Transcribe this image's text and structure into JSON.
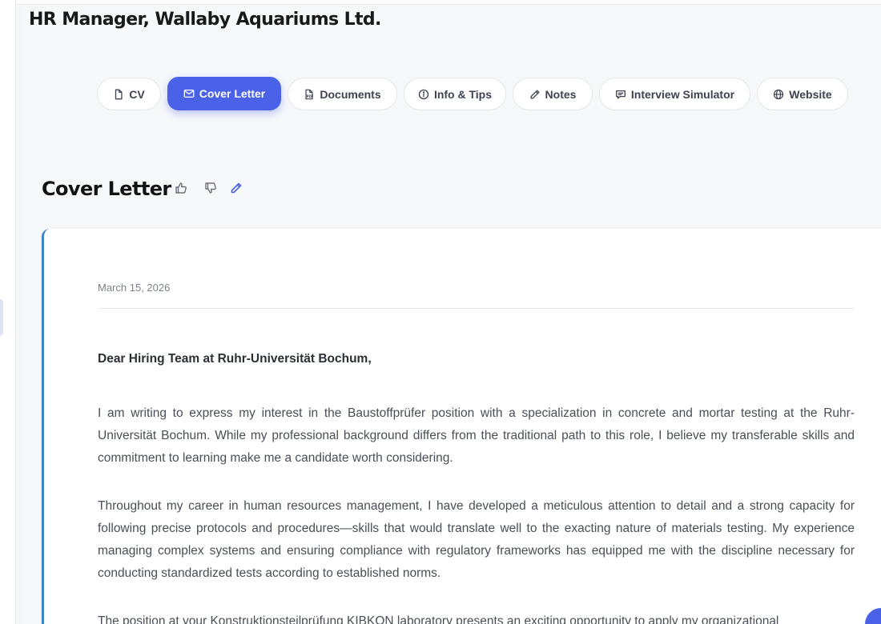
{
  "header": {
    "company_title": "HR Manager, Wallaby Aquariums Ltd."
  },
  "tabs": [
    {
      "label": "CV",
      "icon": "file-icon",
      "active": false
    },
    {
      "label": "Cover Letter",
      "icon": "mail-icon",
      "active": true
    },
    {
      "label": "Documents",
      "icon": "pdf-file-icon",
      "active": false
    },
    {
      "label": "Info & Tips",
      "icon": "info-icon",
      "active": false
    },
    {
      "label": "Notes",
      "icon": "pencil-icon",
      "active": false
    },
    {
      "label": "Interview Simulator",
      "icon": "chat-icon",
      "active": false
    },
    {
      "label": "Website",
      "icon": "globe-icon",
      "active": false
    }
  ],
  "section": {
    "title": "Cover Letter",
    "actions": [
      "thumbs-up-icon",
      "thumbs-down-icon",
      "edit-icon"
    ]
  },
  "letter": {
    "date": "March 15, 2026",
    "greeting": "Dear Hiring Team at Ruhr-Universität Bochum,",
    "paragraphs": [
      "I am writing to express my interest in the Baustoffprüfer position with a specialization in concrete and mortar testing at the Ruhr-Universität Bochum. While my professional background differs from the traditional path to this role, I believe my transferable skills and commitment to learning make me a candidate worth considering.",
      "Throughout my career in human resources management, I have developed a meticulous attention to detail and a strong capacity for following precise protocols and procedures—skills that would translate well to the exacting nature of materials testing. My experience managing complex systems and ensuring compliance with regulatory frameworks has equipped me with the discipline necessary for conducting standardized tests according to established norms.",
      "The position at your Konstruktionsteilprüfung KIBKON laboratory presents an exciting opportunity to apply my organizational"
    ]
  },
  "colors": {
    "accent": "#4a62e8",
    "card_border": "#3b82c9"
  }
}
